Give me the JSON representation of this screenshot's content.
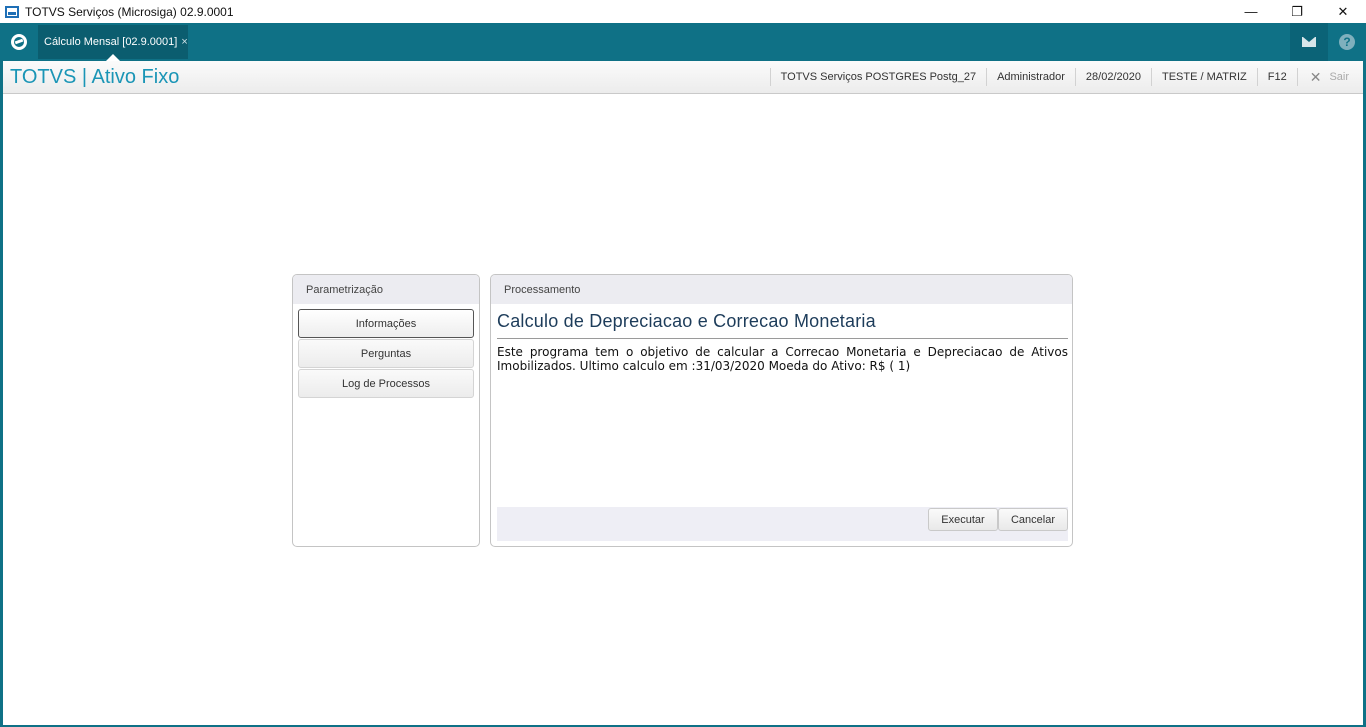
{
  "window": {
    "title": "TOTVS Serviços (Microsiga) 02.9.0001",
    "controls": {
      "minimize": "—",
      "restore": "❐",
      "close": "✕"
    }
  },
  "tabbar": {
    "active_tab": "Cálculo Mensal [02.9.0001]",
    "tab_close": "×",
    "help_glyph": "?"
  },
  "header": {
    "brand": "TOTVS | Ativo Fixo",
    "environment": "TOTVS Serviços POSTGRES Postg_27",
    "user": "Administrador",
    "date": "28/02/2020",
    "company": "TESTE / MATRIZ",
    "shortcut": "F12",
    "exit_label": "Sair"
  },
  "left_panel": {
    "title": "Parametrização",
    "buttons": [
      {
        "label": "Informações",
        "active": true
      },
      {
        "label": "Perguntas",
        "active": false
      },
      {
        "label": "Log de Processos",
        "active": false
      }
    ]
  },
  "right_panel": {
    "title": "Processamento",
    "heading": "Calculo de Depreciacao e Correcao Monetaria",
    "description": "Este programa tem o objetivo de calcular a Correcao Monetaria e Depreciacao de Ativos Imobilizados. Ultimo calculo em :31/03/2020 Moeda do Ativo: R$ ( 1)",
    "execute_label": "Executar",
    "cancel_label": "Cancelar"
  },
  "colors": {
    "accent": "#0f7186",
    "brand_text": "#1a95b6"
  }
}
